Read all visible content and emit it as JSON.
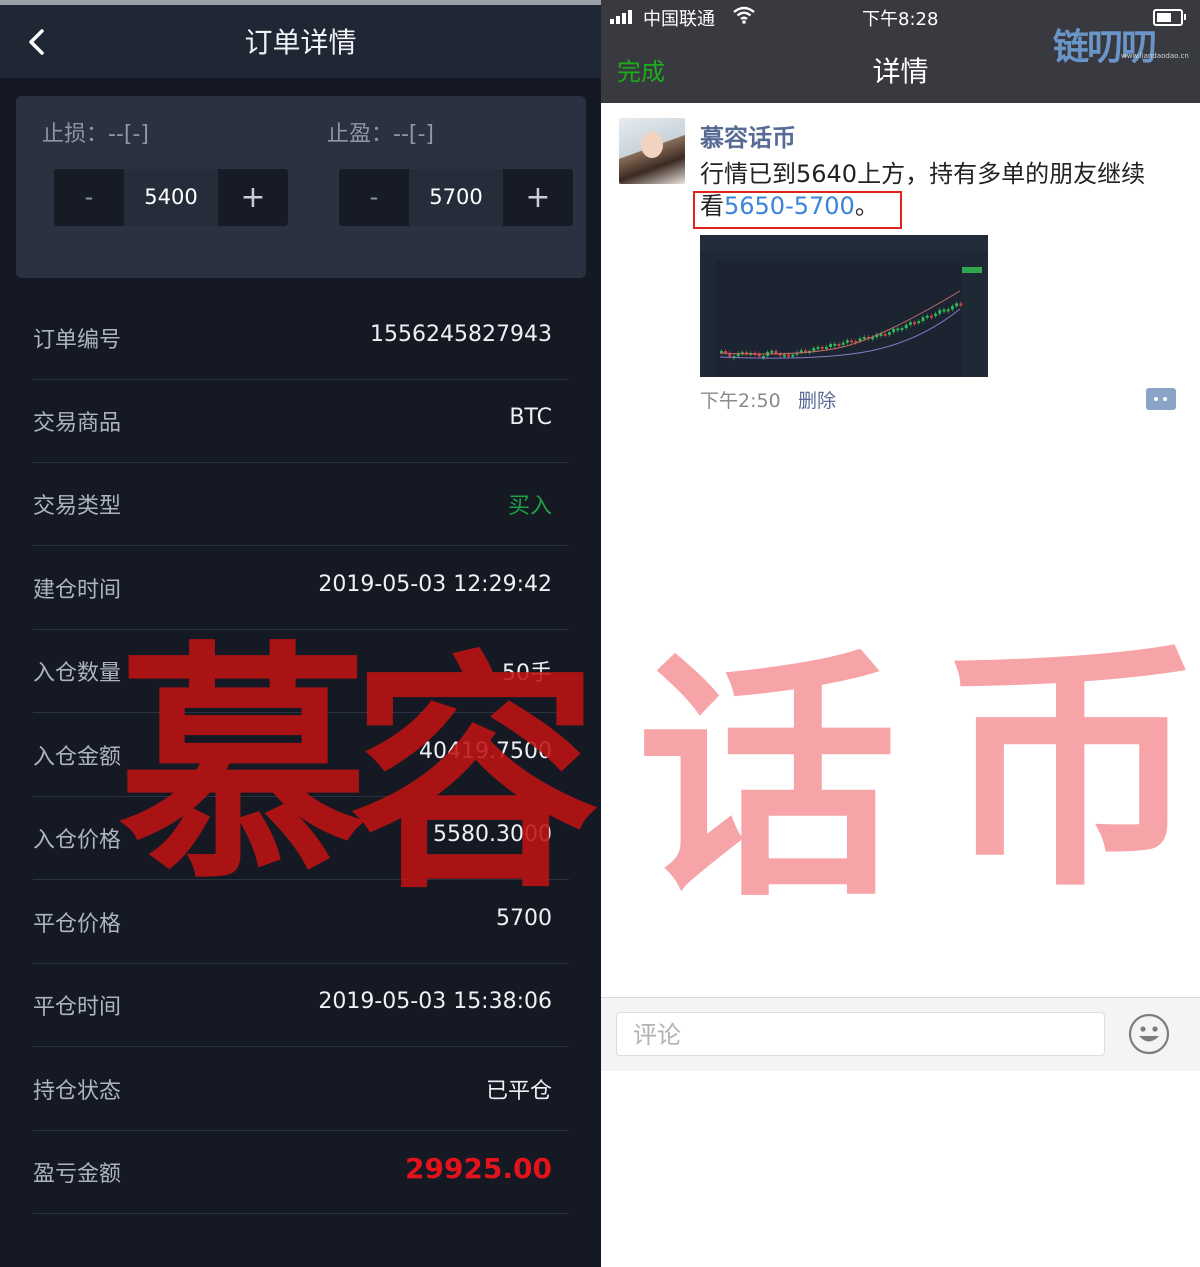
{
  "left": {
    "header": {
      "title": "订单详情"
    },
    "stop_loss": {
      "label": "止损：--[-]",
      "value": "5400"
    },
    "take_profit": {
      "label": "止盈：--[-]",
      "value": "5700"
    },
    "stepper": {
      "minus": "-",
      "plus": "+"
    },
    "rows": [
      {
        "label": "订单编号",
        "value": "1556245827943"
      },
      {
        "label": "交易商品",
        "value": "BTC"
      },
      {
        "label": "交易类型",
        "value": "买入"
      },
      {
        "label": "建仓时间",
        "value": "2019-05-03 12:29:42"
      },
      {
        "label": "入仓数量",
        "value": "50手"
      },
      {
        "label": "入仓金额",
        "value": "40419.7500"
      },
      {
        "label": "入仓价格",
        "value": "5580.3000"
      },
      {
        "label": "平仓价格",
        "value": "5700"
      },
      {
        "label": "平仓时间",
        "value": "2019-05-03 15:38:06"
      },
      {
        "label": "持仓状态",
        "value": "已平仓"
      },
      {
        "label": "盈亏金额",
        "value": "29925.00"
      }
    ],
    "watermark": [
      "慕",
      "容"
    ]
  },
  "right": {
    "status_bar": {
      "carrier": "中国联通",
      "time": "下午8:28"
    },
    "nav": {
      "done": "完成",
      "title": "详情"
    },
    "logo": {
      "text": "链叨叨",
      "sub": "www.liandaodao.cn"
    },
    "post": {
      "author": "慕容话币",
      "line1": "行情已到5640上方，持有多单的朋友继续",
      "line2_prefix": "看",
      "line2_price": "5650-5700",
      "line2_suffix": "。",
      "time": "下午2:50",
      "delete": "删除"
    },
    "comment": {
      "placeholder": "评论"
    },
    "watermark": [
      "话",
      "币"
    ]
  },
  "colors": {
    "left_bg": "#141923",
    "buy_green": "#1e9e45",
    "profit_red": "#e2131b",
    "wechat_green": "#1aad19",
    "link_blue": "#576b95"
  }
}
